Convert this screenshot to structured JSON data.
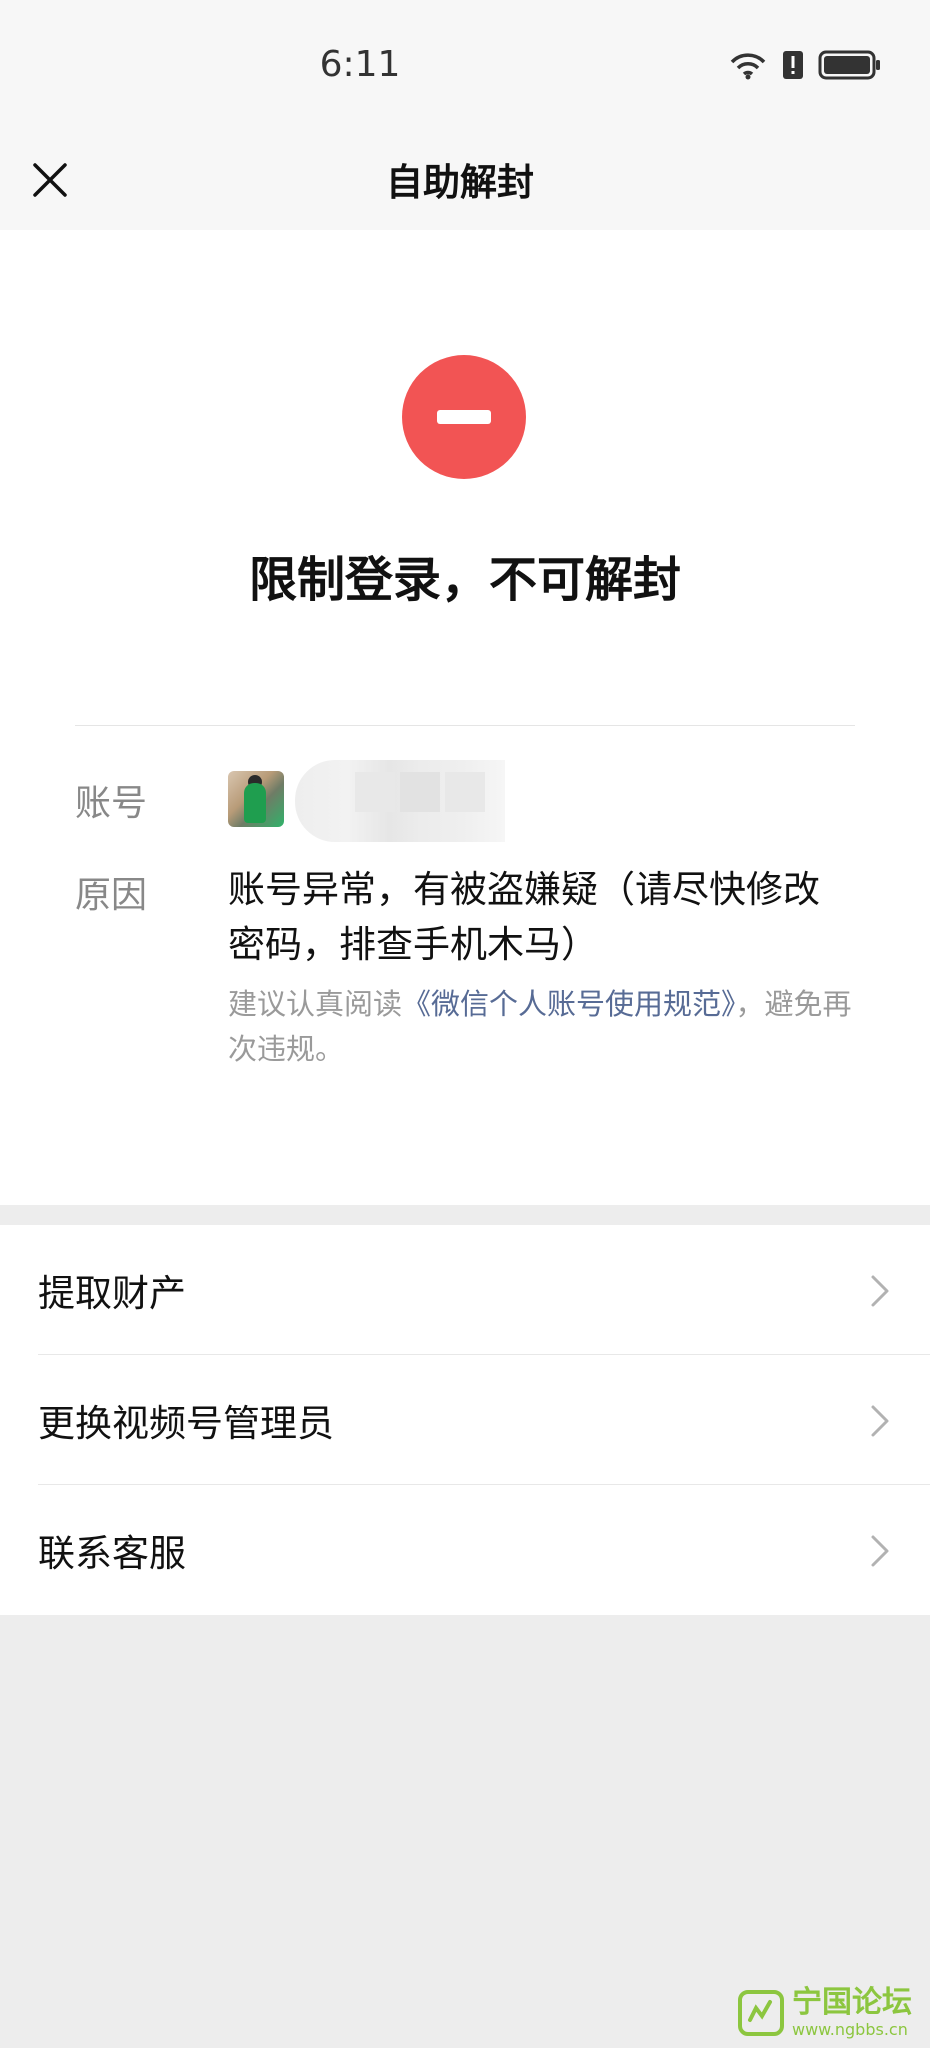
{
  "status_bar": {
    "time": "6:11",
    "icons": [
      "wifi-icon",
      "alert-icon",
      "battery-icon"
    ]
  },
  "nav": {
    "title": "自助解封",
    "close_icon": "close-icon"
  },
  "status": {
    "icon": "minus-circle-icon",
    "icon_color": "#f25454",
    "title": "限制登录，不可解封"
  },
  "account": {
    "label": "账号",
    "avatar": "avatar-image"
  },
  "reason": {
    "label": "原因",
    "text": "账号异常，有被盗嫌疑（请尽快修改密码，排查手机木马）",
    "advice_prefix": "建议认真阅读",
    "advice_link": "《微信个人账号使用规范》",
    "advice_suffix": "，避免再次违规。"
  },
  "actions": [
    {
      "label": "提取财产",
      "icon": "chevron-right-icon"
    },
    {
      "label": "更换视频号管理员",
      "icon": "chevron-right-icon"
    },
    {
      "label": "联系客服",
      "icon": "chevron-right-icon"
    }
  ],
  "watermark": {
    "title": "宁国论坛",
    "url": "www.ngbbs.cn"
  },
  "colors": {
    "accent_red": "#f25454",
    "link_blue": "#576b95",
    "background": "#ededed"
  }
}
